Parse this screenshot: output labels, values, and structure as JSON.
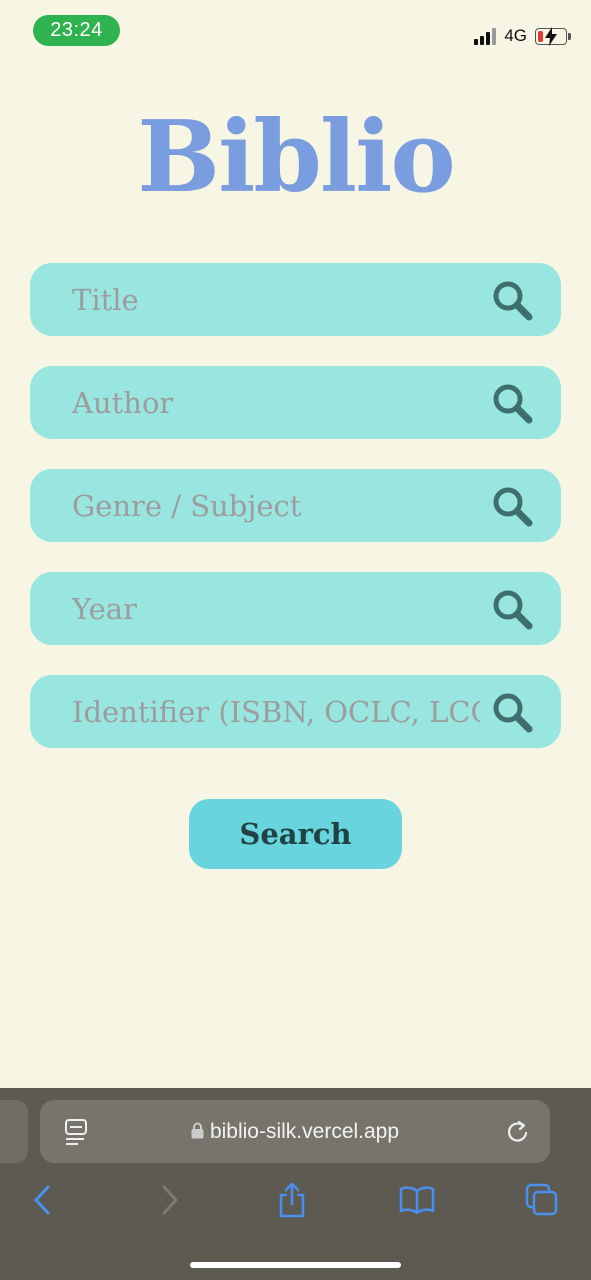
{
  "status_bar": {
    "time": "23:24",
    "network": "4G"
  },
  "app": {
    "title": "Biblio"
  },
  "fields": [
    {
      "placeholder": "Title",
      "icon": "search-icon"
    },
    {
      "placeholder": "Author",
      "icon": "search-icon"
    },
    {
      "placeholder": "Genre / Subject",
      "icon": "search-icon"
    },
    {
      "placeholder": "Year",
      "icon": "search-icon"
    },
    {
      "placeholder": "Identifier (ISBN, OCLC, LCCN, OLID)",
      "icon": "search-icon"
    }
  ],
  "search_button": {
    "label": "Search"
  },
  "browser": {
    "url": "biblio-silk.vercel.app"
  },
  "colors": {
    "background": "#f7f5e3",
    "logo": "#7a9de0",
    "field": "#98e6df",
    "button": "#68d4dd",
    "icon": "#3f6f6c"
  }
}
